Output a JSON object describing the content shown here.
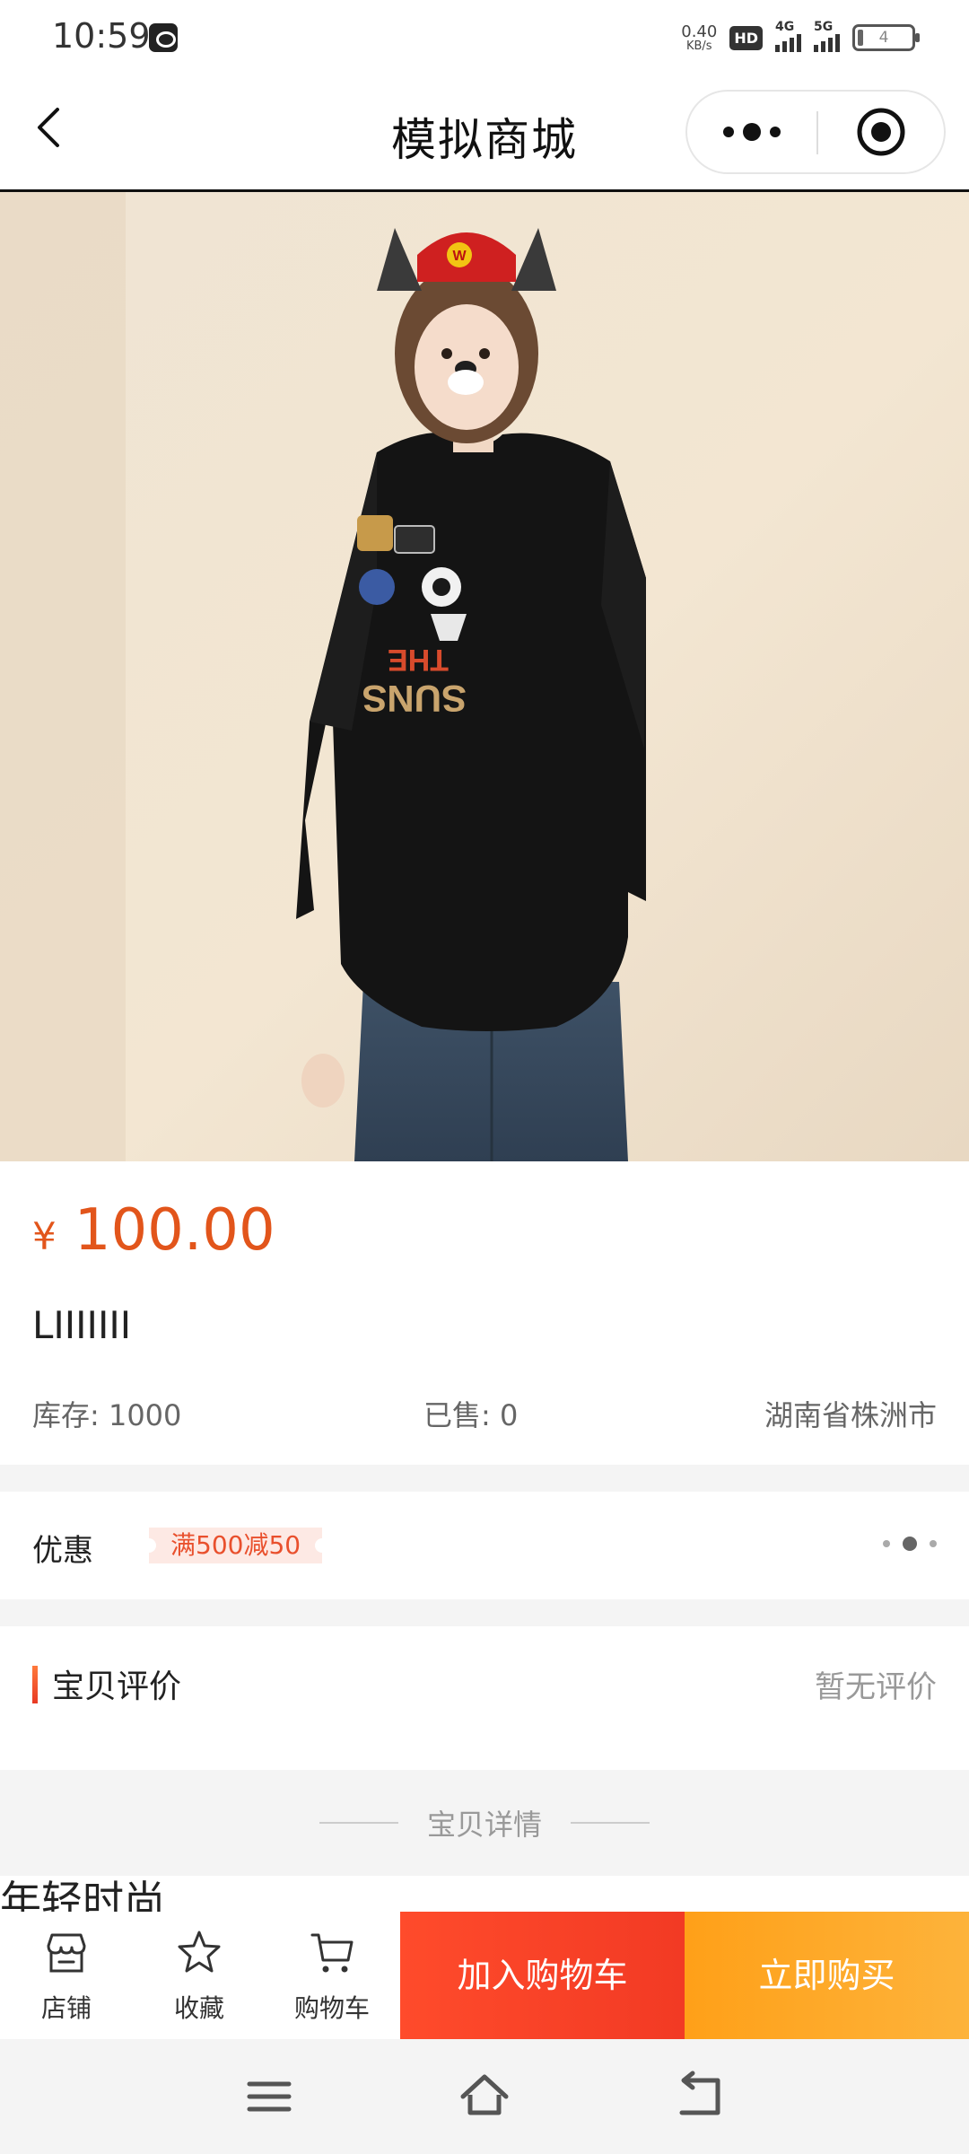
{
  "status_bar": {
    "time": "10:59",
    "net_speed_value": "0.40",
    "net_speed_unit": "KB/s",
    "hd_badge": "HD",
    "signal_1_label": "4G",
    "signal_2_label": "5G",
    "battery_level": "4"
  },
  "nav": {
    "title": "模拟商城",
    "back_icon": "chevron-left-icon",
    "more_icon": "more-dots-icon",
    "close_icon": "target-close-icon"
  },
  "product": {
    "currency_symbol": "¥",
    "price": "100.00",
    "name": "LIIIIIII",
    "stock_label": "库存: 1000",
    "sold_label": "已售: 0",
    "location": "湖南省株洲市",
    "image_pager": {
      "count": 3,
      "active_index": 1
    }
  },
  "promo": {
    "label": "优惠",
    "tag": "满500减50"
  },
  "reviews": {
    "title": "宝贝评价",
    "empty_text": "暂无评价"
  },
  "details": {
    "header": "宝贝详情",
    "text": "年轻时尚"
  },
  "action_bar": {
    "shop_label": "店铺",
    "favorite_label": "收藏",
    "cart_label": "购物车",
    "add_to_cart": "加入购物车",
    "buy_now": "立即购买"
  },
  "colors": {
    "price": "#e2551b",
    "add_to_cart_bg": "#f23a24",
    "buy_now_bg": "#fdb33b"
  }
}
